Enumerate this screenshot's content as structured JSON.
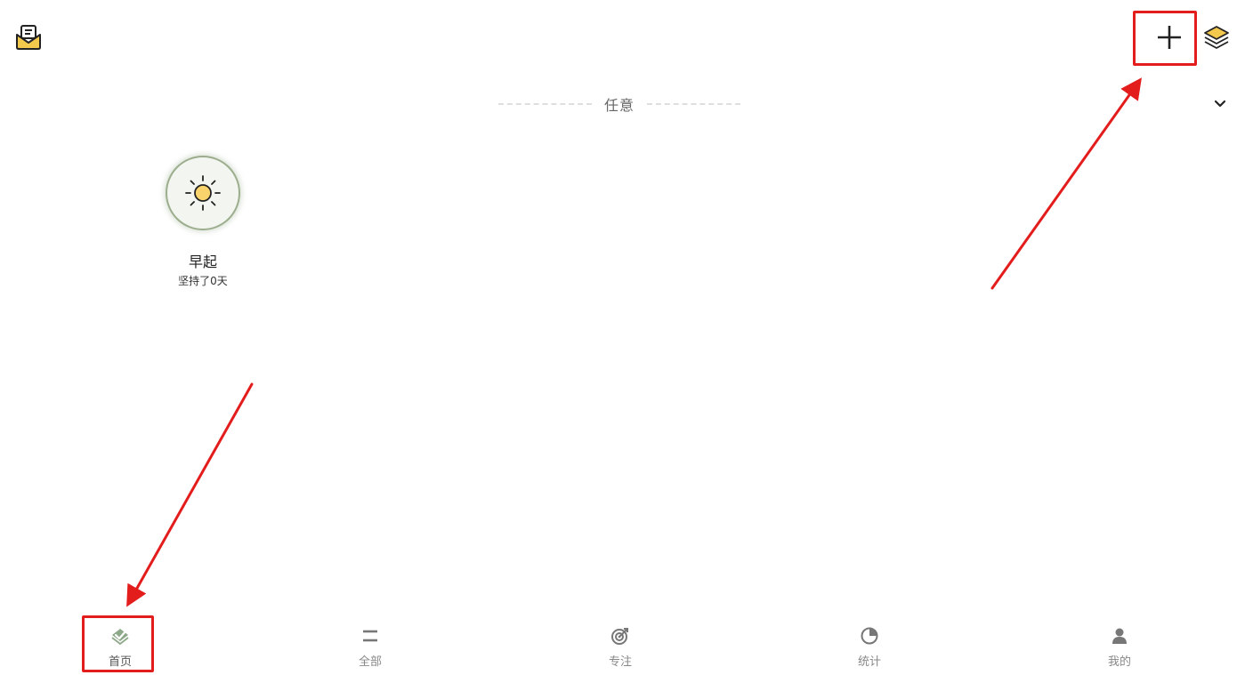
{
  "toolbar": {
    "mail_icon": "mail-icon",
    "add_icon": "plus-icon",
    "layers_icon": "layers-icon"
  },
  "group": {
    "label": "任意",
    "collapse_icon": "chevron-down-icon"
  },
  "habits": [
    {
      "name": "早起",
      "streak": "坚持了0天",
      "icon": "sun-icon"
    }
  ],
  "bottom_nav": {
    "items": [
      {
        "label": "首页",
        "icon": "home-check-icon",
        "active": true
      },
      {
        "label": "全部",
        "icon": "list-icon",
        "active": false
      },
      {
        "label": "专注",
        "icon": "target-icon",
        "active": false
      },
      {
        "label": "统计",
        "icon": "pie-chart-icon",
        "active": false
      },
      {
        "label": "我的",
        "icon": "user-icon",
        "active": false
      }
    ]
  },
  "colors": {
    "accent": "#9cae8e",
    "annotation": "#e31c1c",
    "mail": "#f2c94c",
    "sun": "#f9d36b"
  }
}
